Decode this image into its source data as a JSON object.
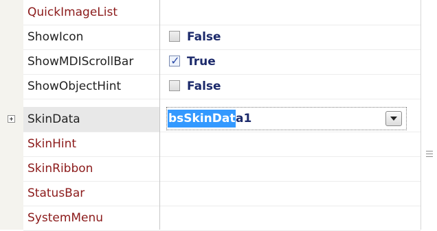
{
  "properties": [
    {
      "name": "QuickImageList",
      "category": true
    },
    {
      "name": "ShowIcon",
      "category": false,
      "checked": false,
      "value": "False"
    },
    {
      "name": "ShowMDIScrollBar",
      "category": false,
      "checked": true,
      "value": "True"
    },
    {
      "name": "ShowObjectHint",
      "category": false,
      "checked": false,
      "value": "False"
    },
    {
      "name": "SkinData",
      "category": false,
      "value_selected": "bsSkinDat",
      "value_rest": "a1"
    },
    {
      "name": "SkinHint",
      "category": true
    },
    {
      "name": "SkinRibbon",
      "category": true
    },
    {
      "name": "StatusBar",
      "category": true
    },
    {
      "name": "SystemMenu",
      "category": true
    }
  ],
  "icons": {
    "expander": "plus-expander-icon",
    "dropdown": "chevron-down-icon",
    "check": "checkmark-icon",
    "grip": "scroll-grip-icon"
  },
  "colors": {
    "category_text": "#8b1a1a",
    "value_text": "#1c2a6b",
    "selection": "#3399ff"
  }
}
